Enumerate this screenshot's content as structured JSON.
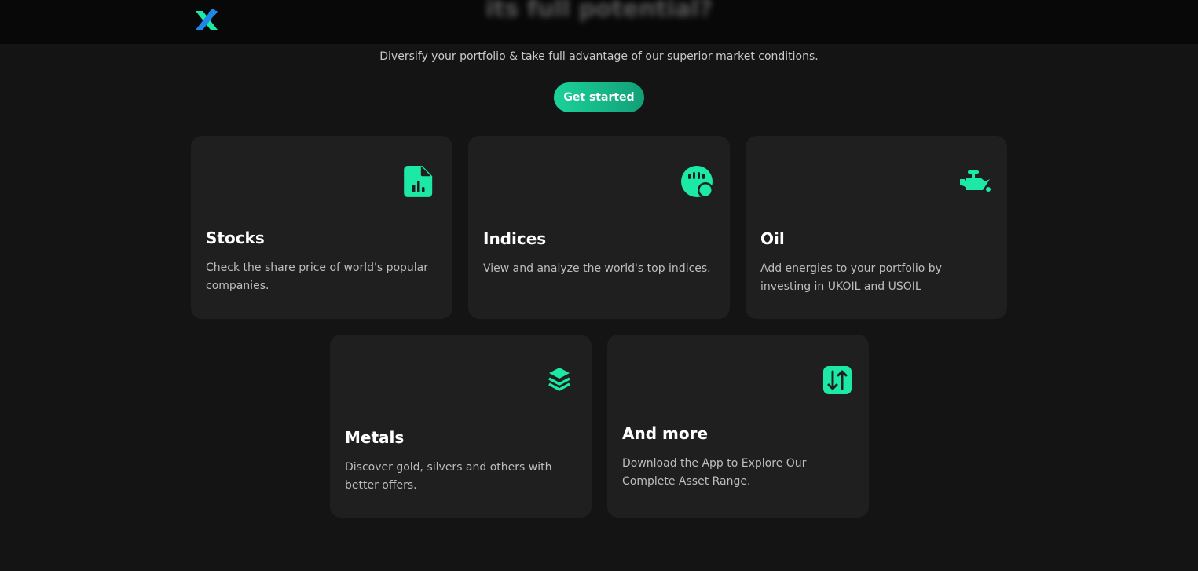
{
  "header": {
    "heading_partial": "its full potential?"
  },
  "hero": {
    "subtitle": "Diversify your portfolio & take full advantage of our superior market conditions.",
    "cta_label": "Get started"
  },
  "colors": {
    "accent": "#1de9a6",
    "background": "#141414",
    "card": "#1f1f1f"
  },
  "cards": [
    {
      "title": "Stocks",
      "description": "Check the share price of world's popular companies.",
      "icon": "stock-document-chart-icon"
    },
    {
      "title": "Indices",
      "description": "View and analyze the world's top indices.",
      "icon": "indices-gauge-icon"
    },
    {
      "title": "Oil",
      "description": "Add energies to your portfolio by investing in UKOIL and USOIL",
      "icon": "oil-can-icon"
    },
    {
      "title": "Metals",
      "description": "Discover gold, silvers and others with better offers.",
      "icon": "layers-icon"
    },
    {
      "title": "And more",
      "description": "Download the App to Explore Our Complete Asset Range.",
      "icon": "arrows-up-down-icon"
    }
  ]
}
